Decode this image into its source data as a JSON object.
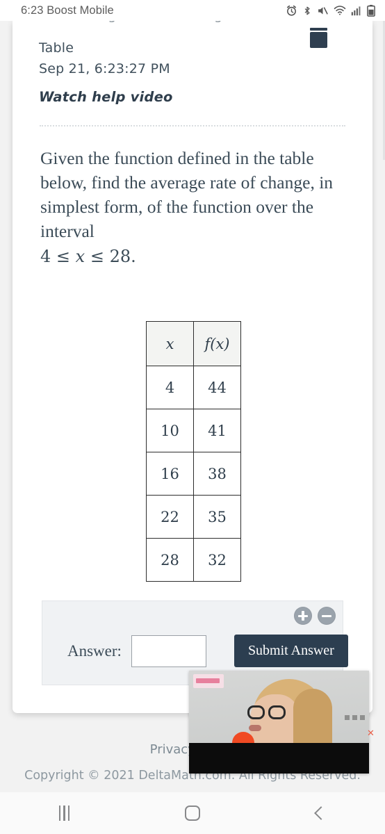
{
  "status_bar": {
    "time_carrier": "6:23 Boost Mobile",
    "icons": [
      "alarm-icon",
      "bluetooth-icon",
      "mute-icon",
      "wifi-icon",
      "signal-icon",
      "battery-icon"
    ]
  },
  "problem": {
    "title_clipped": "Find Average Rate of Change from",
    "title_line2": "Table",
    "timestamp": "Sep 21, 6:23:27 PM",
    "help_video_label": "Watch help video",
    "question_text": "Given the function defined in the table below, find the average rate of change, in simplest form, of the function over the interval",
    "interval_left": "4",
    "interval_rel1": "≤",
    "interval_var": "x",
    "interval_rel2": "≤",
    "interval_right": "28."
  },
  "table": {
    "headers": [
      "x",
      "f(x)"
    ],
    "rows": [
      [
        "4",
        "44"
      ],
      [
        "10",
        "41"
      ],
      [
        "16",
        "38"
      ],
      [
        "22",
        "35"
      ],
      [
        "28",
        "32"
      ]
    ]
  },
  "answer_panel": {
    "label": "Answer:",
    "input_value": "",
    "input_placeholder": "",
    "submit_label": "Submit Answer",
    "zoom_in_label": "+",
    "zoom_out_label": "−"
  },
  "footer": {
    "privacy_label": "Privacy Policy",
    "copyright": "Copyright © 2021 DeltaMath.com. All Rights Reserved."
  },
  "video_overlay": {
    "close_label": "✕"
  },
  "nav_bar": {
    "recents_label": "recents",
    "home_label": "home",
    "back_label": "back"
  },
  "colors": {
    "accent_navy": "#2c3e50",
    "panel_bg": "#f0f2f4",
    "page_bg": "#f2f2f2",
    "text_dark": "#3b4b57",
    "mic_orange": "#f04a23"
  }
}
